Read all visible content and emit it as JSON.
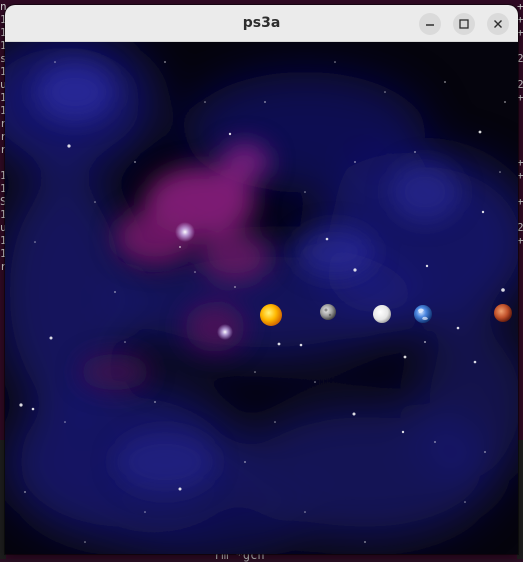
{
  "window": {
    "title": "ps3a"
  },
  "background_terminal": {
    "left_gutter": "n\n1\n1\n1\ns\n1\nu\n1\n1\nr\nr\nr\n\n1\n1\nS\n1\nu\n1\n1\nr",
    "right_gutter": "+\n+\n+\n\n2\n\n2\n+\n\n\n\n\n+\n+\n\n+\n\n2\n+",
    "bottom_text": "rm *gch"
  },
  "controls": {
    "minimize_icon": "minimize-icon",
    "maximize_icon": "maximize-icon",
    "close_icon": "close-icon"
  },
  "scene": {
    "background_color": "#05040d",
    "nebula_colors": [
      "#1a1a7a",
      "#2a2aa8",
      "#7a1a6e",
      "#b02aa0"
    ],
    "bodies": [
      {
        "name": "sun",
        "color": "#ffb000"
      },
      {
        "name": "mercury",
        "color": "#b8b8b8"
      },
      {
        "name": "venus",
        "color": "#f2f2f2"
      },
      {
        "name": "earth",
        "color": "#3b78d8"
      },
      {
        "name": "mars",
        "color": "#c0502a"
      }
    ]
  }
}
